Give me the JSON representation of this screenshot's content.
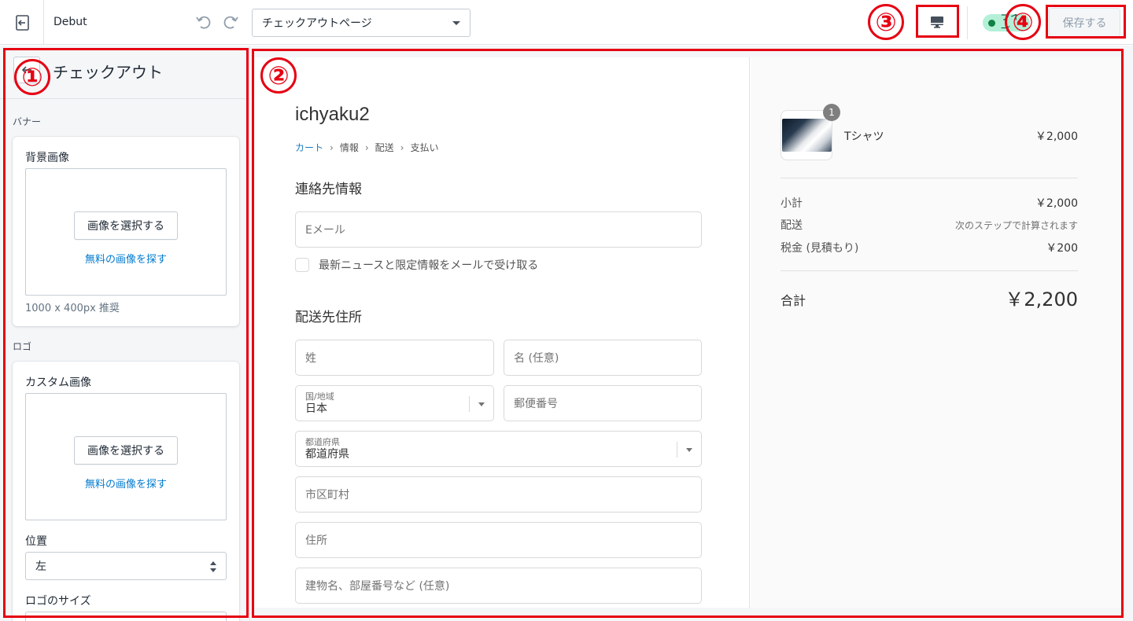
{
  "topbar": {
    "theme_name": "Debut",
    "page_select": "チェックアウトページ",
    "save_label": "保存する",
    "live_label": "ライブ"
  },
  "sidebar": {
    "title": "チェックアウト",
    "banner_section": "バナー",
    "background_image_label": "背景画像",
    "select_image": "画像を選択する",
    "free_images": "無料の画像を探す",
    "banner_hint": "1000 x 400px 推奨",
    "logo_section": "ロゴ",
    "custom_image_label": "カスタム画像",
    "position_label": "位置",
    "position_value": "左",
    "logo_size_label": "ロゴのサイズ"
  },
  "checkout": {
    "shop_name": "ichyaku2",
    "breadcrumbs": [
      "カート",
      "情報",
      "配送",
      "支払い"
    ],
    "contact_heading": "連絡先情報",
    "email_placeholder": "Eメール",
    "newsletter_label": "最新ニュースと限定情報をメールで受け取る",
    "shipping_heading": "配送先住所",
    "last_name": "姓",
    "first_name": "名 (任意)",
    "country_label": "国/地域",
    "country_value": "日本",
    "postal_code": "郵便番号",
    "prefecture_label": "都道府県",
    "prefecture_value": "都道府県",
    "city": "市区町村",
    "address": "住所",
    "building": "建物名、部屋番号など (任意)"
  },
  "summary": {
    "item_qty": "1",
    "item_name": "Tシャツ",
    "item_price": "￥2,000",
    "subtotal_label": "小計",
    "subtotal_value": "￥2,000",
    "shipping_label": "配送",
    "shipping_value": "次のステップで計算されます",
    "tax_label": "税金 (見積もり)",
    "tax_value": "￥200",
    "total_label": "合計",
    "total_value": "￥2,200"
  },
  "annotations": [
    "①",
    "②",
    "③",
    "④"
  ],
  "colors": {
    "annotation_red": "#e60012",
    "link_blue": "#197bbd",
    "live_green": "#108043"
  }
}
